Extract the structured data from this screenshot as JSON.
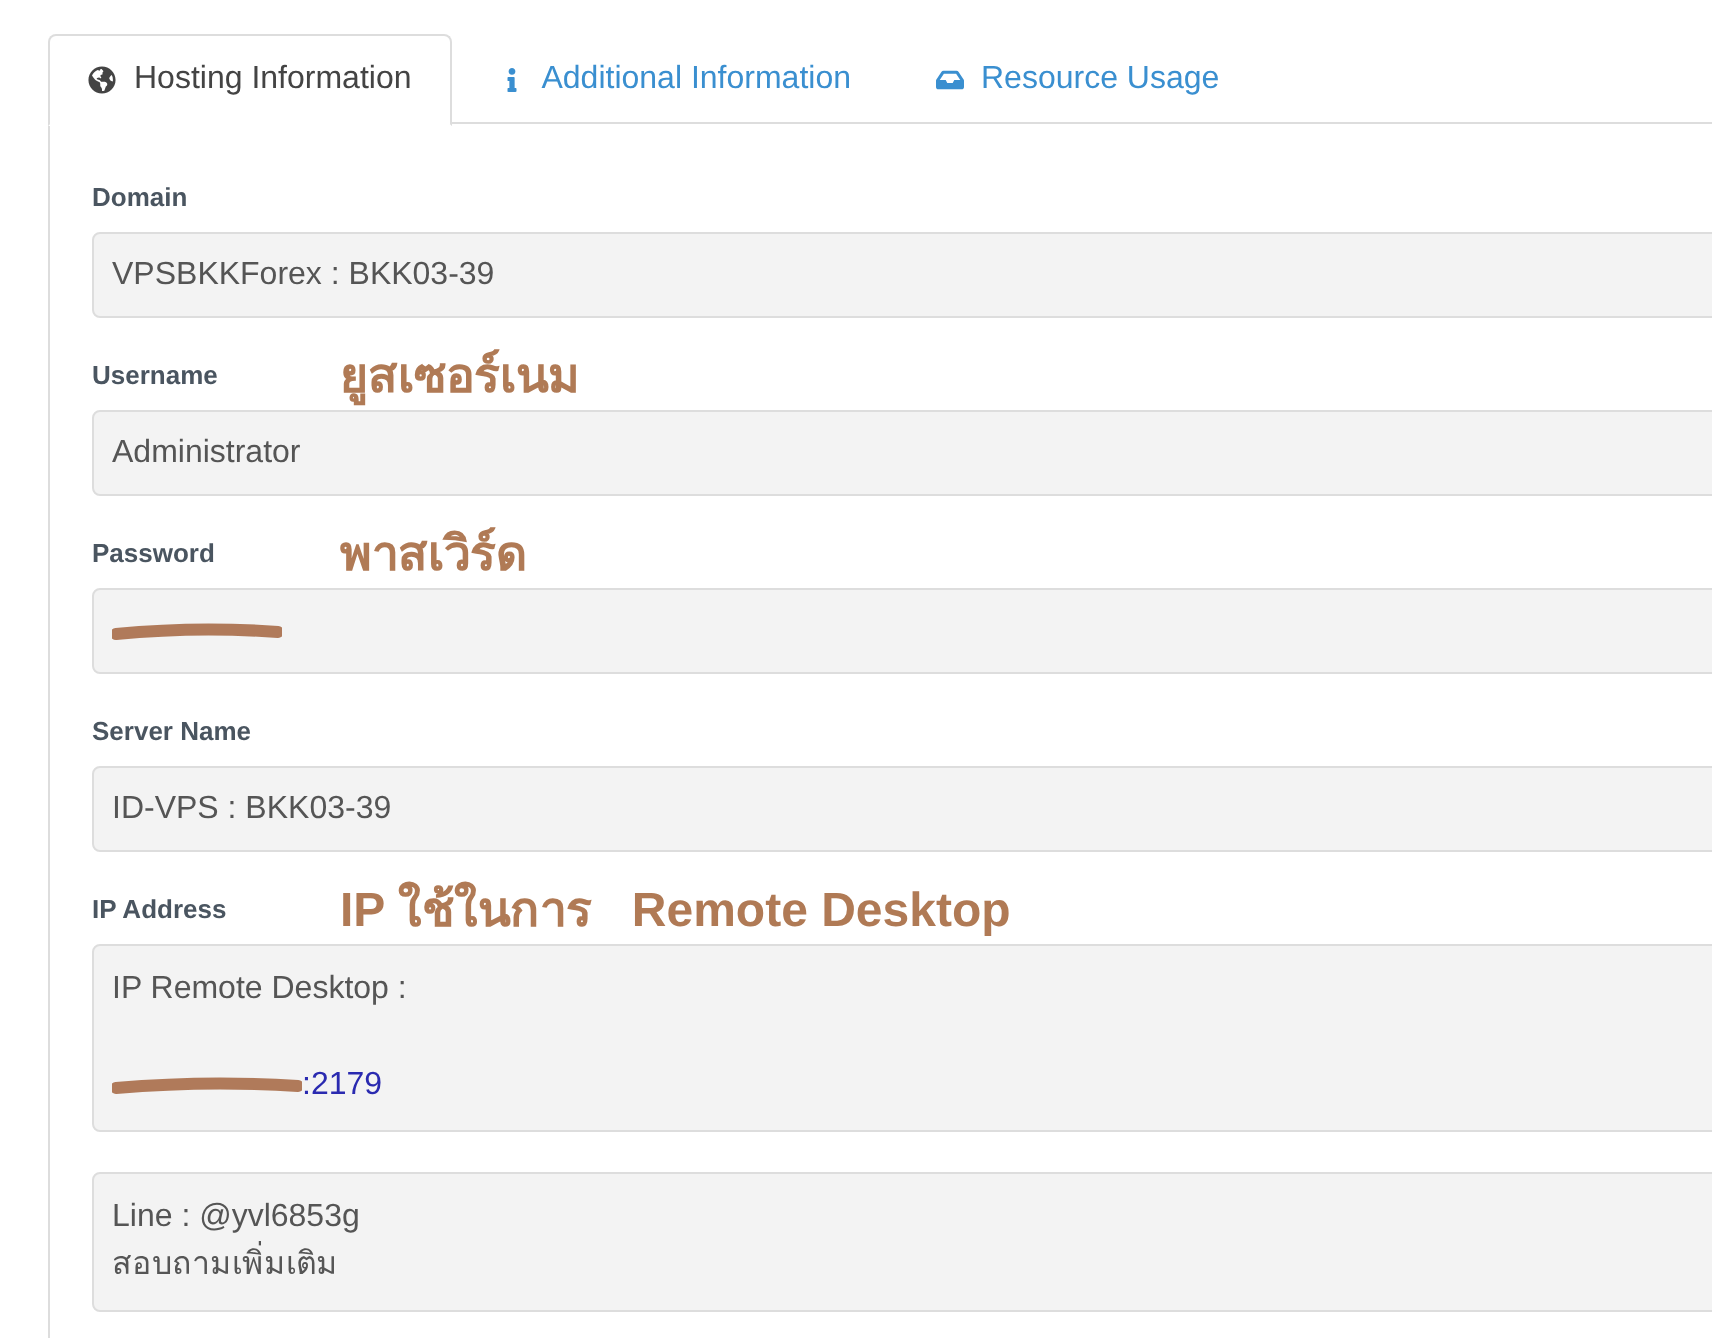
{
  "tabs": [
    {
      "label": "Hosting Information",
      "selected": true
    },
    {
      "label": "Additional Information",
      "selected": false
    },
    {
      "label": "Resource Usage",
      "selected": false
    }
  ],
  "fields": [
    {
      "label": "Domain",
      "value": "VPSBKKForex : BKK03-39"
    },
    {
      "label": "Username",
      "note": "ยูสเซอร์เนม",
      "value": "Administrator"
    },
    {
      "label": "Password",
      "note": "พาสเวิร์ด",
      "redacted": true
    },
    {
      "label": "Server Name",
      "value": "ID-VPS : BKK03-39"
    },
    {
      "label": "IP Address",
      "note": "IP ใช้ในการ   Remote Desktop",
      "lines": [
        "IP Remote Desktop :"
      ],
      "link": ":2179",
      "redacted": true
    }
  ],
  "contact": {
    "lines": [
      "Line : @yvl6853g",
      "สอบถามเพิ่มเติม"
    ]
  }
}
